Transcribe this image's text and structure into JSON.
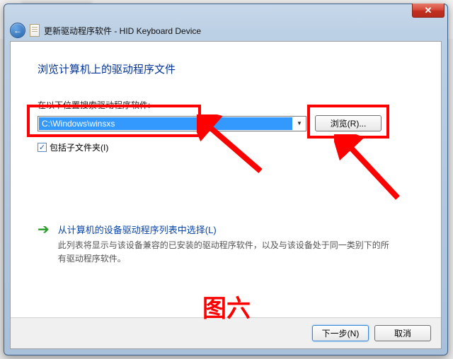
{
  "header": {
    "title": "更新驱动程序软件 - HID Keyboard Device"
  },
  "page": {
    "heading": "浏览计算机上的驱动程序文件",
    "search_label": "在以下位置搜索驱动程序软件:",
    "path_value": "C:\\Windows\\winsxs",
    "browse_label": "浏览(R)...",
    "include_subfolders_label": "包括子文件夹(I)",
    "picklist": {
      "title": "从计算机的设备驱动程序列表中选择(L)",
      "description": "此列表将显示与该设备兼容的已安装的驱动程序软件，以及与该设备处于同一类别下的所有驱动程序软件。"
    }
  },
  "footer": {
    "next_label": "下一步(N)",
    "cancel_label": "取消"
  },
  "annotation": {
    "figure_label": "图六"
  },
  "colors": {
    "accent": "#003399",
    "link": "#0645ad",
    "highlight_bg": "#3399ff",
    "annotate": "#ff0000"
  }
}
